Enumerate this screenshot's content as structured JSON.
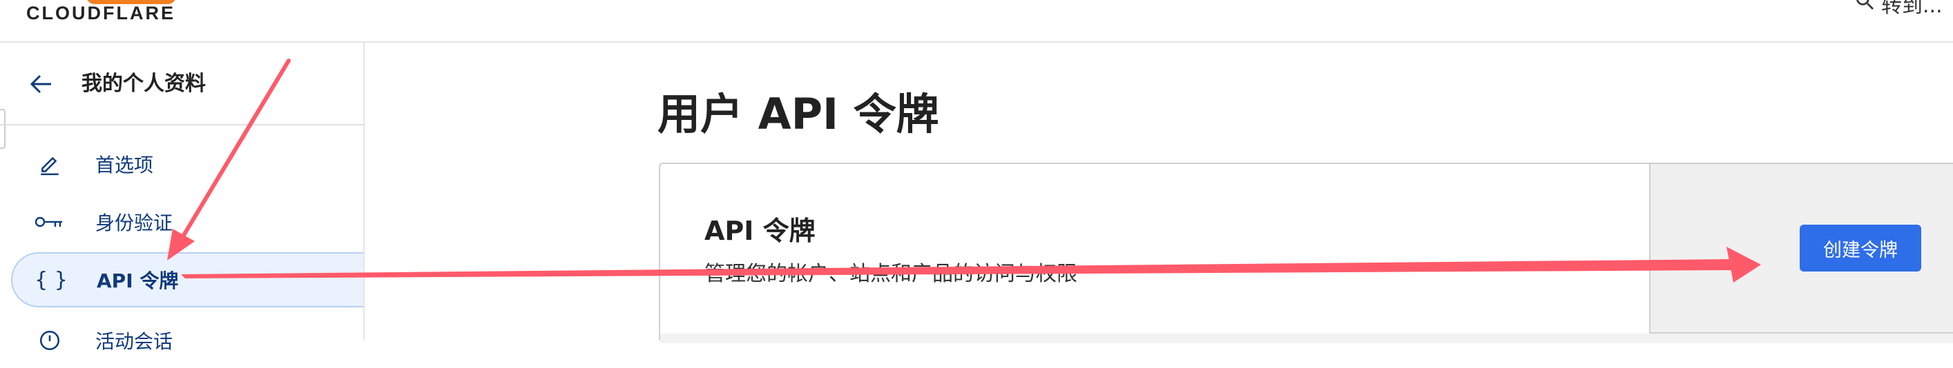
{
  "header": {
    "logo_text": "CLOUDFLARE",
    "goto_label": "转到..."
  },
  "sidebar": {
    "title": "我的个人资料",
    "items": [
      {
        "label": "首选项",
        "icon": "pencil-icon",
        "active": false
      },
      {
        "label": "身份验证",
        "icon": "key-icon",
        "active": false
      },
      {
        "label": "API 令牌",
        "icon": "braces-icon",
        "active": true
      },
      {
        "label": "活动会话",
        "icon": "clock-icon",
        "active": false
      }
    ]
  },
  "main": {
    "page_title": "用户 API 令牌",
    "card": {
      "title": "API 令牌",
      "description": "管理您的帐户、站点和产品的访问与权限",
      "create_button": "创建令牌"
    }
  },
  "colors": {
    "accent": "#2f6ee9",
    "nav_text": "#0f3a7a",
    "annotation": "#ff5a6a",
    "brand_orange": "#f38020"
  }
}
